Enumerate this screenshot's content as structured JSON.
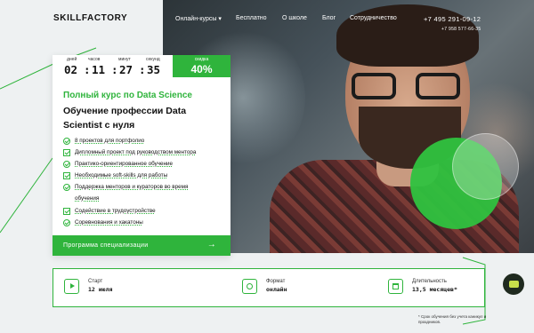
{
  "header": {
    "logo": "SKILLFACTORY",
    "nav": [
      "Онлайн-курсы ▾",
      "Бесплатно",
      "О школе",
      "Блог",
      "Сотрудничество"
    ],
    "phone_main": "+7 495 291-09-12",
    "phone_secondary": "+7 958 577-66-35"
  },
  "timer": {
    "days_label": "дней",
    "days": "02",
    "hours_label": "часов",
    "hours": "11",
    "minutes_label": "минут",
    "minutes": "27",
    "seconds_label": "секунд",
    "seconds": "35",
    "sep": ":"
  },
  "discount": {
    "label": "скидка",
    "value": "40%"
  },
  "course": {
    "title": "Полный курс по Data Science",
    "headline": "Обучение профессии Data Scientist с нуля"
  },
  "features": [
    "8 проектов для портфолио",
    "Дипломный проект под руководством ментора",
    "Практико-ориентированное обучение",
    "Необходимые soft-skills для работы",
    "Поддержка менторов и кураторов во время",
    "обучения",
    "Содействие в трудоустройстве",
    "Соревнования и хакатоны"
  ],
  "cta": {
    "label": "Программа специализации",
    "arrow": "→"
  },
  "info": {
    "start_label": "Старт",
    "start_value": "12 июля",
    "format_label": "Формат",
    "format_value": "онлайн",
    "duration_label": "Длительность",
    "duration_value": "13,5 месяцев*"
  },
  "note": "* Срок обучения без учета каникул и праздников.",
  "colors": {
    "accent": "#2fb43c",
    "background": "#eef1f2"
  }
}
